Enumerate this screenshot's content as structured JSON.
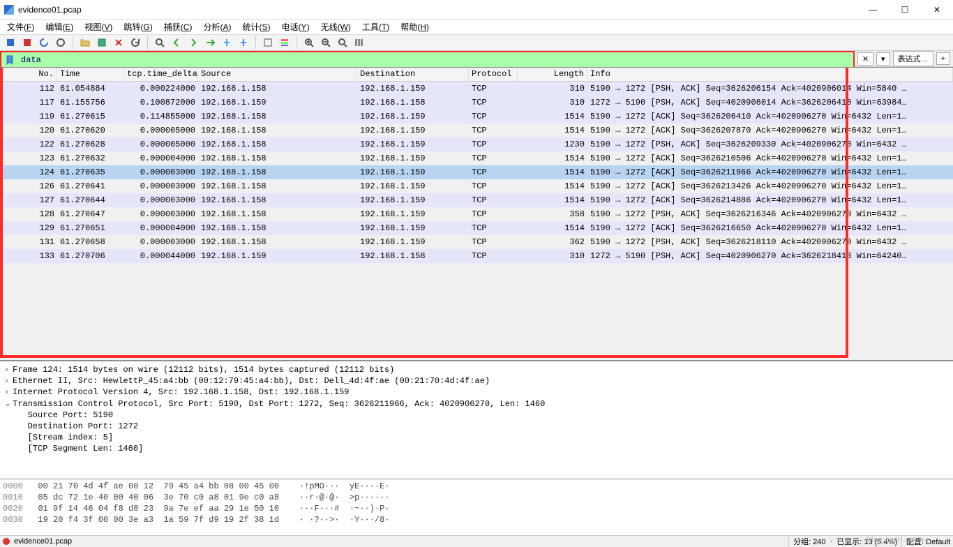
{
  "window": {
    "title": "evidence01.pcap"
  },
  "menu": {
    "file": {
      "label": "文件",
      "accel": "F"
    },
    "edit": {
      "label": "编辑",
      "accel": "E"
    },
    "view": {
      "label": "视图",
      "accel": "V"
    },
    "go": {
      "label": "跳转",
      "accel": "G"
    },
    "capture": {
      "label": "捕获",
      "accel": "C"
    },
    "analyze": {
      "label": "分析",
      "accel": "A"
    },
    "stats": {
      "label": "统计",
      "accel": "S"
    },
    "telephony": {
      "label": "电话",
      "accel": "Y"
    },
    "wireless": {
      "label": "无线",
      "accel": "W"
    },
    "tools": {
      "label": "工具",
      "accel": "T"
    },
    "help": {
      "label": "帮助",
      "accel": "H"
    }
  },
  "filter": {
    "value": "data",
    "expr_btn": "表达式…",
    "plus": "+"
  },
  "columns": {
    "no": "No.",
    "time": "Time",
    "delta": "tcp.time_delta",
    "src": "Source",
    "dst": "Destination",
    "proto": "Protocol",
    "len": "Length",
    "info": "Info"
  },
  "packets": [
    {
      "no": 112,
      "time": "61.054884",
      "delta": "0.000224000",
      "src": "192.168.1.158",
      "dst": "192.168.1.159",
      "proto": "TCP",
      "len": 310,
      "info": "5190 → 1272 [PSH, ACK] Seq=3626206154 Ack=4020906014 Win=5840 …",
      "alt": true
    },
    {
      "no": 117,
      "time": "61.155756",
      "delta": "0.100872000",
      "src": "192.168.1.159",
      "dst": "192.168.1.158",
      "proto": "TCP",
      "len": 310,
      "info": "1272 → 5190 [PSH, ACK] Seq=4020906014 Ack=3626206410 Win=63984…",
      "alt": true
    },
    {
      "no": 119,
      "time": "61.270615",
      "delta": "0.114855000",
      "src": "192.168.1.158",
      "dst": "192.168.1.159",
      "proto": "TCP",
      "len": 1514,
      "info": "5190 → 1272 [ACK] Seq=3626206410 Ack=4020906270 Win=6432 Len=1…",
      "alt": true
    },
    {
      "no": 120,
      "time": "61.270620",
      "delta": "0.000005000",
      "src": "192.168.1.158",
      "dst": "192.168.1.159",
      "proto": "TCP",
      "len": 1514,
      "info": "5190 → 1272 [ACK] Seq=3626207870 Ack=4020906270 Win=6432 Len=1…",
      "alt": false
    },
    {
      "no": 122,
      "time": "61.270628",
      "delta": "0.000005000",
      "src": "192.168.1.158",
      "dst": "192.168.1.159",
      "proto": "TCP",
      "len": 1230,
      "info": "5190 → 1272 [PSH, ACK] Seq=3626209330 Ack=4020906270 Win=6432 …",
      "alt": true
    },
    {
      "no": 123,
      "time": "61.270632",
      "delta": "0.000004000",
      "src": "192.168.1.158",
      "dst": "192.168.1.159",
      "proto": "TCP",
      "len": 1514,
      "info": "5190 → 1272 [ACK] Seq=3626210506 Ack=4020906270 Win=6432 Len=1…",
      "alt": false
    },
    {
      "no": 124,
      "time": "61.270635",
      "delta": "0.000003000",
      "src": "192.168.1.158",
      "dst": "192.168.1.159",
      "proto": "TCP",
      "len": 1514,
      "info": "5190 → 1272 [ACK] Seq=3626211966 Ack=4020906270 Win=6432 Len=1…",
      "sel": true
    },
    {
      "no": 126,
      "time": "61.270641",
      "delta": "0.000003000",
      "src": "192.168.1.158",
      "dst": "192.168.1.159",
      "proto": "TCP",
      "len": 1514,
      "info": "5190 → 1272 [ACK] Seq=3626213426 Ack=4020906270 Win=6432 Len=1…",
      "alt": false
    },
    {
      "no": 127,
      "time": "61.270644",
      "delta": "0.000003000",
      "src": "192.168.1.158",
      "dst": "192.168.1.159",
      "proto": "TCP",
      "len": 1514,
      "info": "5190 → 1272 [ACK] Seq=3626214886 Ack=4020906270 Win=6432 Len=1…",
      "alt": true
    },
    {
      "no": 128,
      "time": "61.270647",
      "delta": "0.000003000",
      "src": "192.168.1.158",
      "dst": "192.168.1.159",
      "proto": "TCP",
      "len": 358,
      "info": "5190 → 1272 [PSH, ACK] Seq=3626216346 Ack=4020906270 Win=6432 …",
      "alt": false
    },
    {
      "no": 129,
      "time": "61.270651",
      "delta": "0.000004000",
      "src": "192.168.1.158",
      "dst": "192.168.1.159",
      "proto": "TCP",
      "len": 1514,
      "info": "5190 → 1272 [ACK] Seq=3626216650 Ack=4020906270 Win=6432 Len=1…",
      "alt": true
    },
    {
      "no": 131,
      "time": "61.270658",
      "delta": "0.000003000",
      "src": "192.168.1.158",
      "dst": "192.168.1.159",
      "proto": "TCP",
      "len": 362,
      "info": "5190 → 1272 [PSH, ACK] Seq=3626218110 Ack=4020906270 Win=6432 …",
      "alt": false
    },
    {
      "no": 133,
      "time": "61.270706",
      "delta": "0.000044000",
      "src": "192.168.1.159",
      "dst": "192.168.1.158",
      "proto": "TCP",
      "len": 310,
      "info": "1272 → 5190 [PSH, ACK] Seq=4020906270 Ack=3626218418 Win=64240…",
      "alt": true
    }
  ],
  "details": [
    {
      "chev": ">",
      "text": "Frame 124: 1514 bytes on wire (12112 bits), 1514 bytes captured (12112 bits)"
    },
    {
      "chev": ">",
      "text": "Ethernet II, Src: HewlettP_45:a4:bb (00:12:79:45:a4:bb), Dst: Dell_4d:4f:ae (00:21:70:4d:4f:ae)"
    },
    {
      "chev": ">",
      "text": "Internet Protocol Version 4, Src: 192.168.1.158, Dst: 192.168.1.159"
    },
    {
      "chev": "v",
      "text": "Transmission Control Protocol, Src Port: 5190, Dst Port: 1272, Seq: 3626211966, Ack: 4020906270, Len: 1460"
    },
    {
      "chev": " ",
      "text": "   Source Port: 5190"
    },
    {
      "chev": " ",
      "text": "   Destination Port: 1272"
    },
    {
      "chev": " ",
      "text": "   [Stream index: 5]"
    },
    {
      "chev": " ",
      "text": "   [TCP Segment Len: 1460]"
    }
  ],
  "hex": [
    {
      "offset": "0000",
      "bytes": "00 21 70 4d 4f ae 00 12  79 45 a4 bb 08 00 45 00",
      "ascii": "·!pMO···  yE····E·"
    },
    {
      "offset": "0010",
      "bytes": "05 dc 72 1e 40 00 40 06  3e 70 c0 a8 01 9e c0 a8",
      "ascii": "··r·@·@·  >p······"
    },
    {
      "offset": "0020",
      "bytes": "01 9f 14 46 04 f8 d8 23  9a 7e ef aa 29 1e 50 10",
      "ascii": "···F···#  ·~··)·P·"
    },
    {
      "offset": "0030",
      "bytes": "19 20 f4 3f 00 00 3e a3  1a 59 7f d9 19 2f 38 1d",
      "ascii": "· ·?··>·  ·Y···/8·"
    }
  ],
  "status": {
    "file": "evidence01.pcap",
    "packets": "分组: 240",
    "displayed": "已显示: 13 (5.4%)",
    "profile": "配置: Default"
  },
  "watermark": "blog.csdn.net/q…"
}
